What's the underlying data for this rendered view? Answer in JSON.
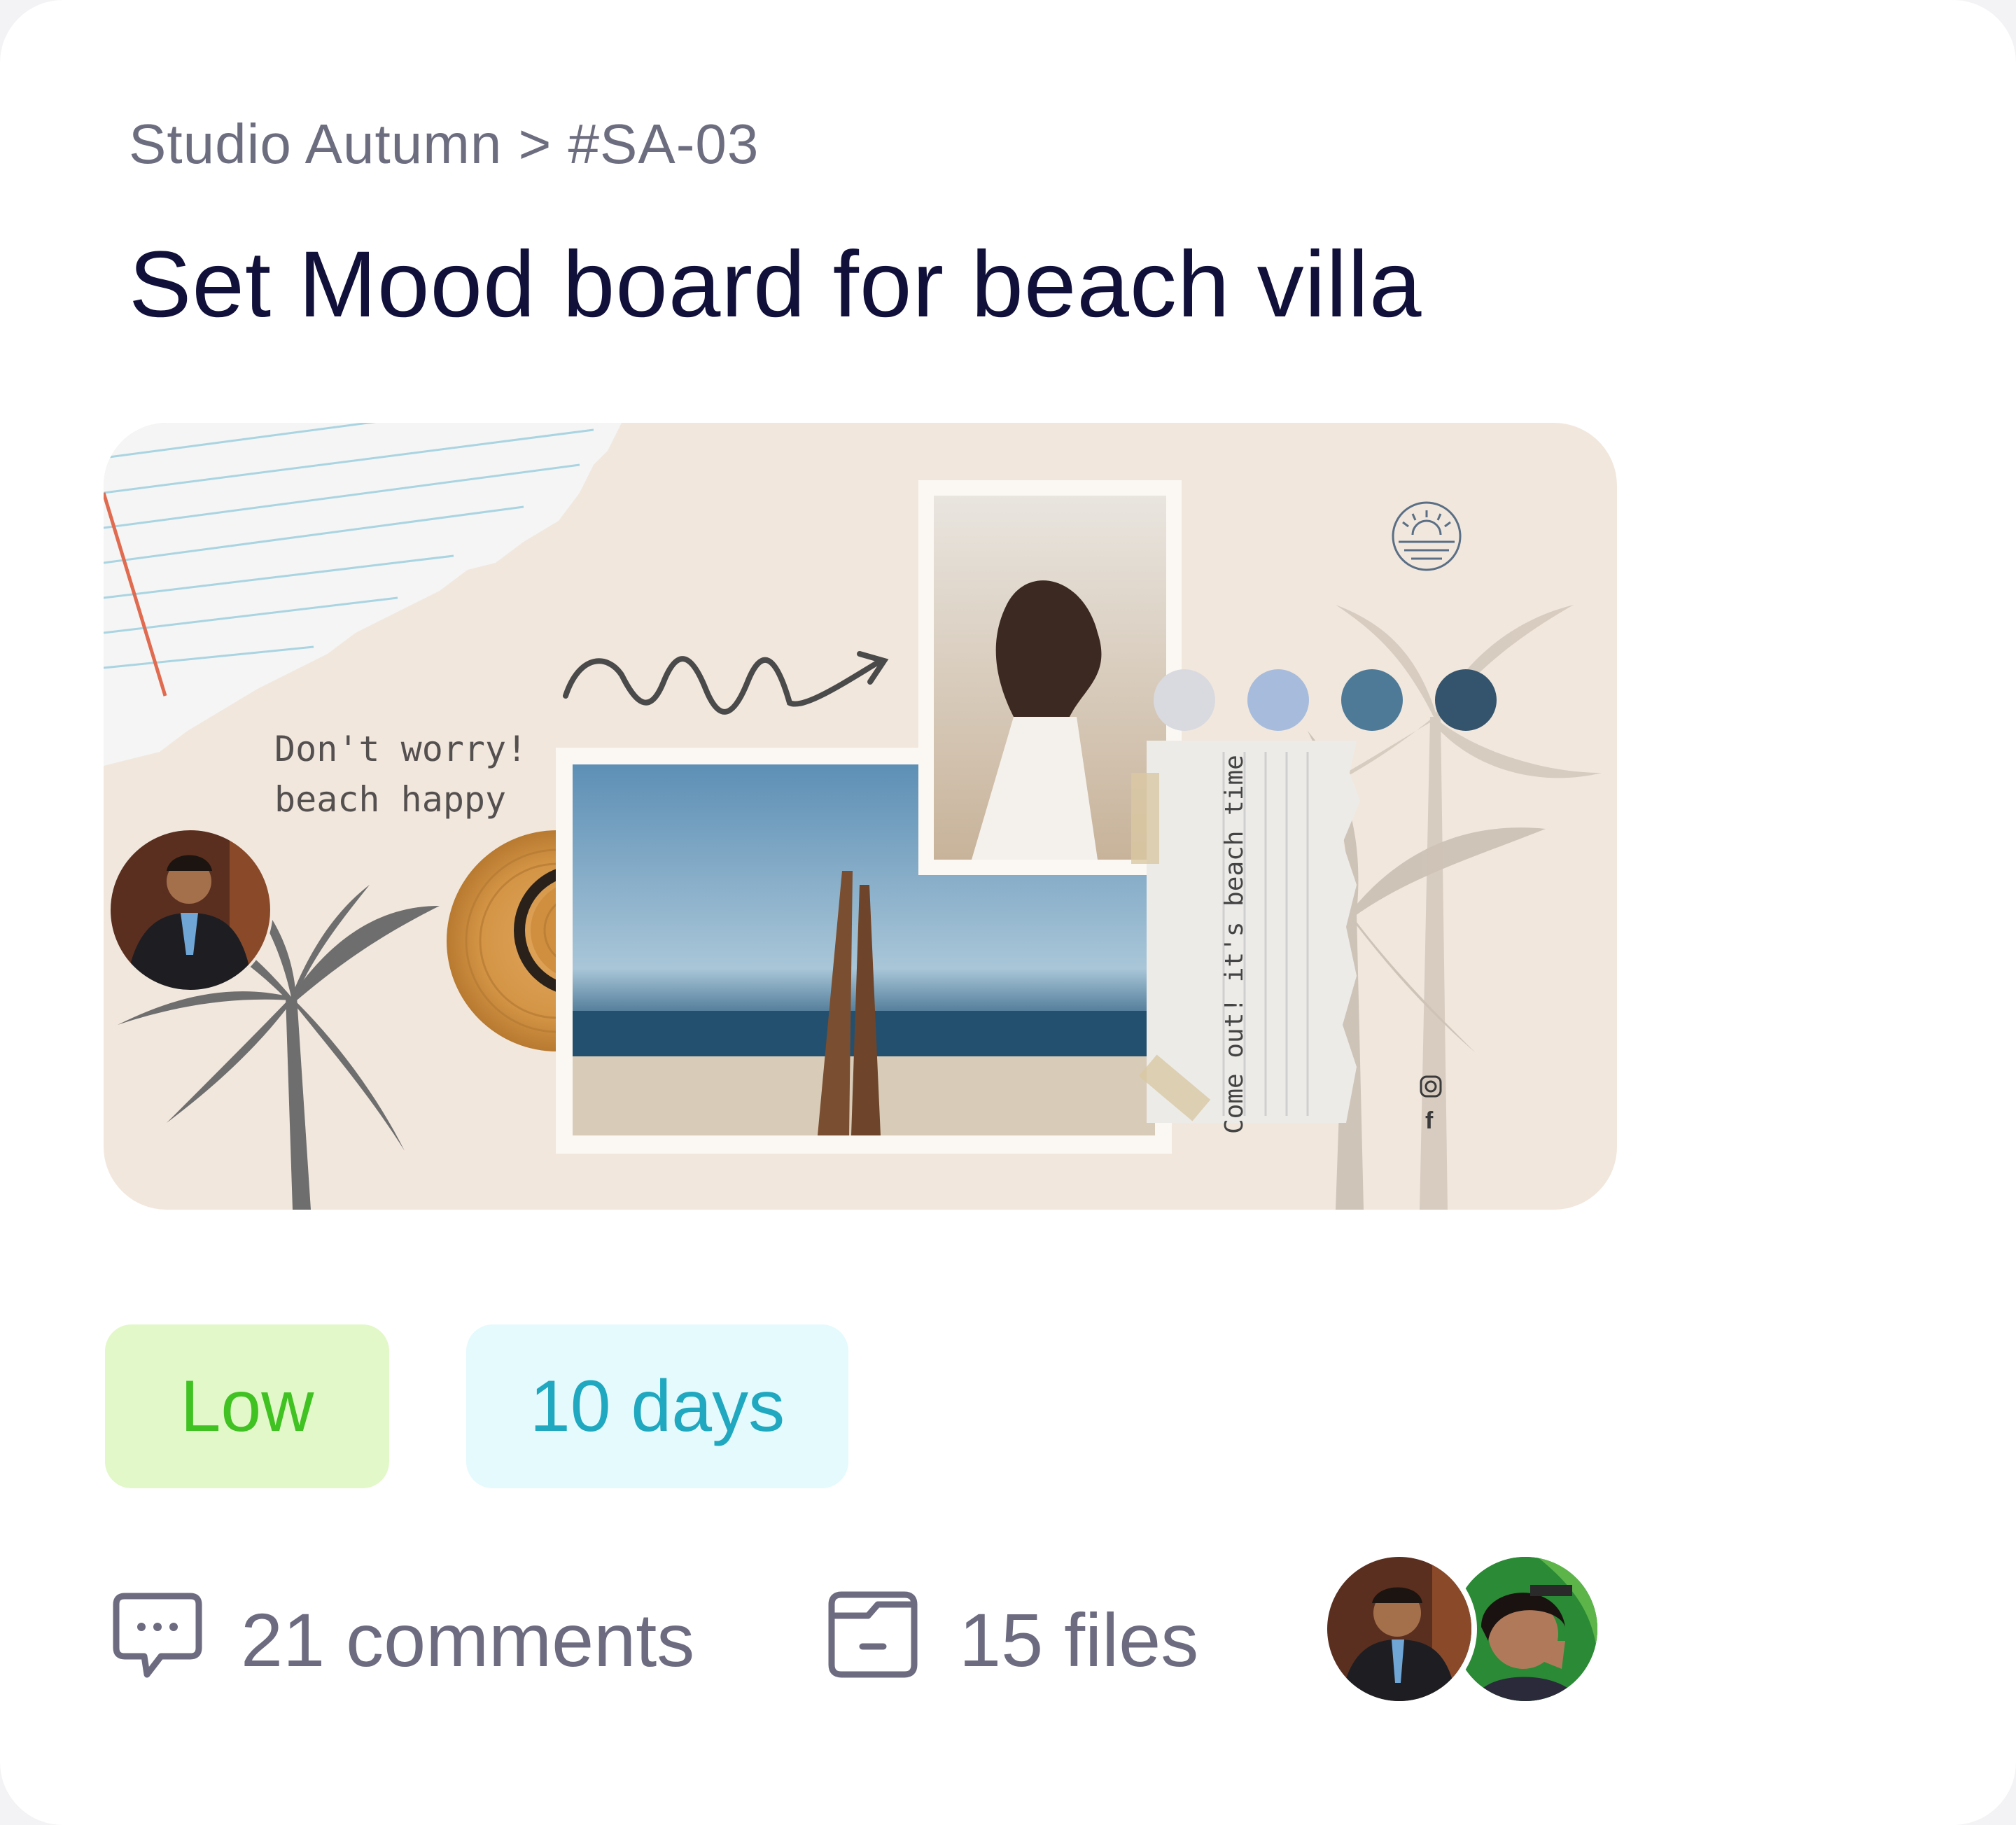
{
  "card": {
    "breadcrumb": "Studio Autumn > #SA-03",
    "title": "Set Mood board for beach villa"
  },
  "moodboard": {
    "tagline": "Don't worry!\nbeach happy",
    "note": "Come out! it's beach time",
    "swatches": [
      "#d9dadf",
      "#a7bcdc",
      "#4e7a98",
      "#34546d"
    ],
    "social_icons": [
      "instagram-icon",
      "facebook-icon"
    ]
  },
  "tags": {
    "priority": "Low",
    "duration": "10 days"
  },
  "meta": {
    "comments": "21 comments",
    "files": "15 files"
  },
  "colors": {
    "title": "#10103a",
    "muted": "#6d6b80",
    "priority_bg": "#e2f8c8",
    "priority_text": "#3fc222",
    "duration_bg": "#e4fafd",
    "duration_text": "#1fa8bf"
  }
}
